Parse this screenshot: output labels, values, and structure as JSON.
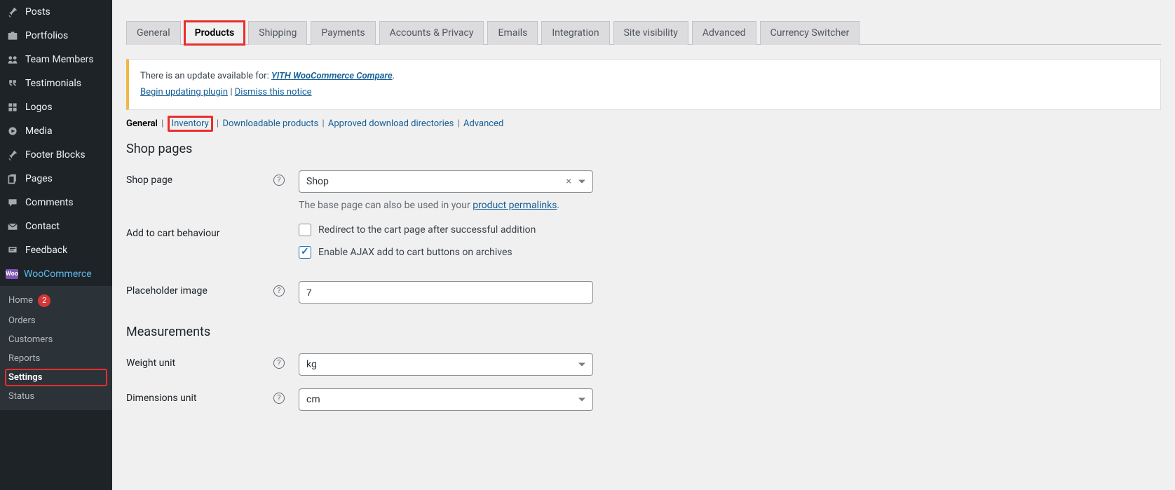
{
  "sidebar": {
    "items": [
      {
        "label": "Posts"
      },
      {
        "label": "Portfolios"
      },
      {
        "label": "Team Members"
      },
      {
        "label": "Testimonials"
      },
      {
        "label": "Logos"
      },
      {
        "label": "Media"
      },
      {
        "label": "Footer Blocks"
      },
      {
        "label": "Pages"
      },
      {
        "label": "Comments"
      },
      {
        "label": "Contact"
      },
      {
        "label": "Feedback"
      }
    ],
    "woo_label": "WooCommerce",
    "submenu": {
      "home": "Home",
      "home_badge": "2",
      "orders": "Orders",
      "customers": "Customers",
      "reports": "Reports",
      "settings": "Settings",
      "status": "Status"
    }
  },
  "tabs": {
    "general": "General",
    "products": "Products",
    "shipping": "Shipping",
    "payments": "Payments",
    "accounts": "Accounts & Privacy",
    "emails": "Emails",
    "integration": "Integration",
    "visibility": "Site visibility",
    "advanced": "Advanced",
    "currency": "Currency Switcher"
  },
  "notice": {
    "prefix": "There is an update available for: ",
    "plugin": "YITH WooCommerce Compare",
    "suffix": ".",
    "begin": "Begin updating plugin",
    "sep": " | ",
    "dismiss": "Dismiss this notice"
  },
  "subsub": {
    "general": "General",
    "inventory": "Inventory",
    "downloadable": "Downloadable products",
    "approved": "Approved download directories",
    "advanced": "Advanced"
  },
  "sections": {
    "shop_pages": "Shop pages",
    "measurements": "Measurements"
  },
  "form": {
    "shop_page_label": "Shop page",
    "shop_page_value": "Shop",
    "shop_page_desc_prefix": "The base page can also be used in your ",
    "shop_page_desc_link": "product permalinks",
    "shop_page_desc_suffix": ".",
    "add_to_cart_label": "Add to cart behaviour",
    "cb_redirect": "Redirect to the cart page after successful addition",
    "cb_ajax": "Enable AJAX add to cart buttons on archives",
    "placeholder_label": "Placeholder image",
    "placeholder_value": "7",
    "weight_label": "Weight unit",
    "weight_value": "kg",
    "dimensions_label": "Dimensions unit",
    "dimensions_value": "cm",
    "help_glyph": "?"
  }
}
